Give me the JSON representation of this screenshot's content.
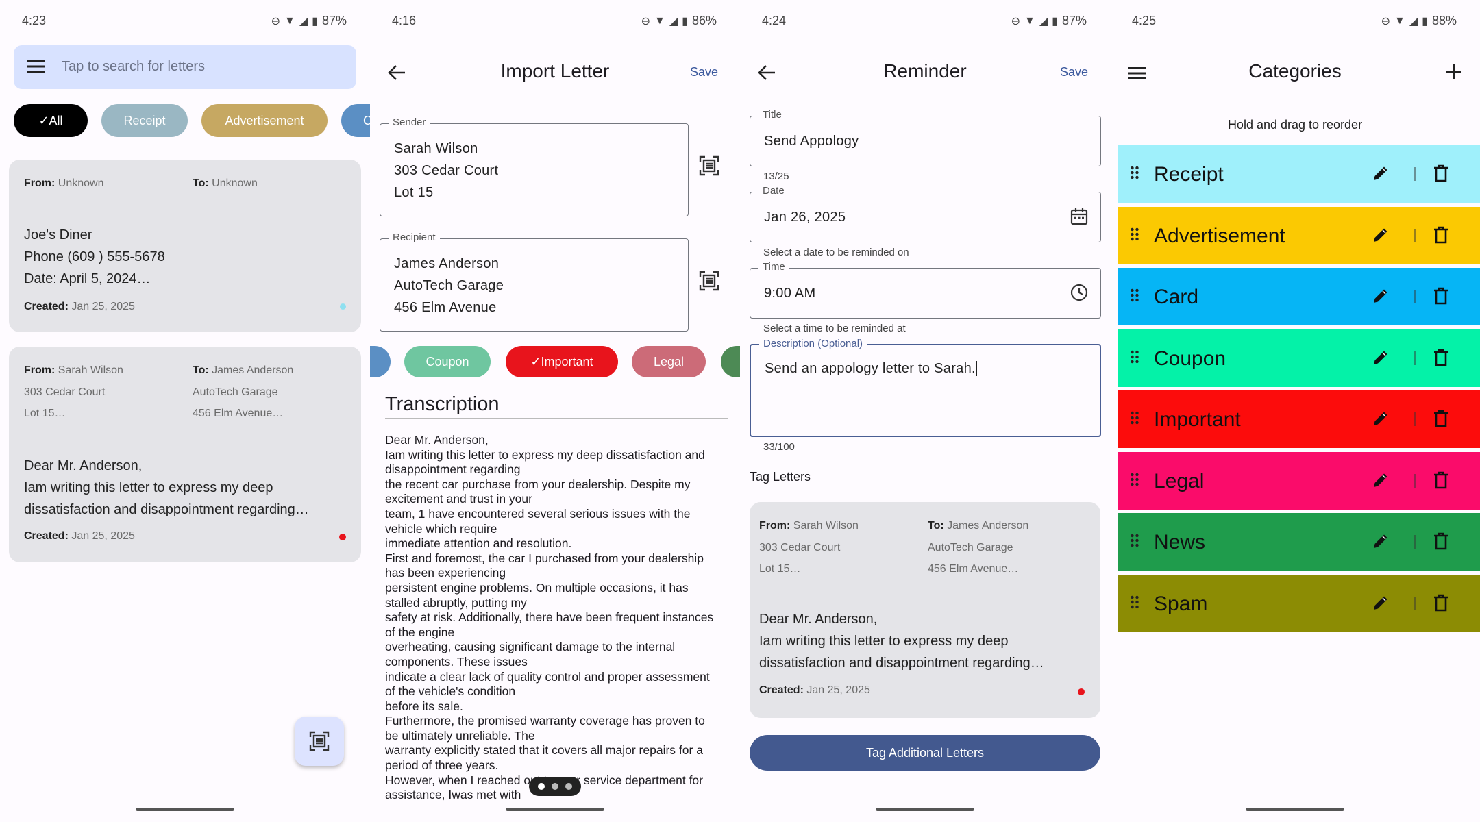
{
  "screen1": {
    "status": {
      "time": "4:23",
      "battery": "87%"
    },
    "search": {
      "placeholder": "Tap to search for letters"
    },
    "filters": [
      {
        "label": "All",
        "color": "#000000"
      },
      {
        "label": "Receipt",
        "color": "#9ab7c3"
      },
      {
        "label": "Advertisement",
        "color": "#c6a862"
      },
      {
        "label": "C",
        "color": "#5b8fc4"
      }
    ],
    "letters": [
      {
        "from_label": "From:",
        "from": "Unknown",
        "to_label": "To:",
        "to": "Unknown",
        "body": [
          "Joe's Diner",
          "Phone (609 ) 555-5678",
          "Date: April 5, 2024…"
        ],
        "created_label": "Created:",
        "created": "Jan 25, 2025",
        "dot_color": "#8fe0f0"
      },
      {
        "from_label": "From:",
        "from": "Sarah Wilson",
        "from_lines": [
          "303 Cedar Court",
          "Lot 15…"
        ],
        "to_label": "To:",
        "to": "James Anderson",
        "to_lines": [
          "AutoTech Garage",
          "456 Elm Avenue…"
        ],
        "body": [
          "Dear Mr. Anderson,",
          "Iam writing this letter to express my deep",
          "dissatisfaction and disappointment regarding…"
        ],
        "created_label": "Created:",
        "created": "Jan 25, 2025",
        "dot_color": "#e8141c"
      }
    ],
    "fab_icon": "scan-document-icon"
  },
  "screen2": {
    "status": {
      "time": "4:16",
      "battery": "86%"
    },
    "title": "Import Letter",
    "save": "Save",
    "sender": {
      "label": "Sender",
      "lines": [
        "Sarah Wilson",
        "303 Cedar Court",
        "Lot 15"
      ]
    },
    "recipient": {
      "label": "Recipient",
      "lines": [
        "James Anderson",
        "AutoTech Garage",
        "456 Elm Avenue"
      ]
    },
    "tags": [
      {
        "label": "",
        "color": "#5b8fc4"
      },
      {
        "label": "Coupon",
        "color": "#6fc6a0"
      },
      {
        "label": "Important",
        "color": "#e8141c",
        "selected": true
      },
      {
        "label": "Legal",
        "color": "#cc6b78"
      },
      {
        "label": "",
        "color": "#4d8a55"
      }
    ],
    "transcription_heading": "Transcription",
    "transcription": [
      "Dear Mr. Anderson,",
      "Iam writing this letter to express my deep dissatisfaction and",
      "disappointment regarding",
      "the recent car purchase from your dealership. Despite my",
      "excitement and trust in your",
      "team, 1 have encountered several serious issues with the",
      "vehicle which require",
      "immediate attention and resolution.",
      "First and foremost, the car I purchased from your dealership",
      "has been experiencing",
      "persistent engine problems. On multiple occasions, it has",
      "stalled abruptly, putting my",
      "safety at risk. Additionally, there have been frequent instances",
      "of the engine",
      "overheating, causing significant damage to the internal",
      "components. These issues",
      "indicate a clear lack of quality control and proper assessment",
      "of the vehicle's condition",
      "before its sale.",
      "Furthermore, the promised warranty coverage has proven to",
      "be ultimately unreliable. The",
      "warranty explicitly stated that it covers all major repairs for a",
      "period of three years.",
      "However, when I reached out to your service department for",
      "assistance, Iwas met with"
    ]
  },
  "screen3": {
    "status": {
      "time": "4:24",
      "battery": "87%"
    },
    "title": "Reminder",
    "save": "Save",
    "title_field": {
      "label": "Title",
      "value": "Send Appology",
      "counter": "13/25"
    },
    "date_field": {
      "label": "Date",
      "value": "Jan 26, 2025",
      "helper": "Select a date to be reminded on"
    },
    "time_field": {
      "label": "Time",
      "value": "9:00 AM",
      "helper": "Select a time to be reminded at"
    },
    "desc_field": {
      "label": "Description (Optional)",
      "value": "Send an appology letter to Sarah.",
      "counter": "33/100"
    },
    "tag_letters": "Tag Letters",
    "letter": {
      "from_label": "From:",
      "from": "Sarah Wilson",
      "from_lines": [
        "303 Cedar Court",
        "Lot 15…"
      ],
      "to_label": "To:",
      "to": "James Anderson",
      "to_lines": [
        "AutoTech Garage",
        "456 Elm Avenue…"
      ],
      "body": [
        "Dear Mr. Anderson,",
        "Iam writing this letter to express my deep",
        "dissatisfaction and disappointment regarding…"
      ],
      "created_label": "Created:",
      "created": "Jan 25, 2025",
      "dot_color": "#e8141c"
    },
    "button": "Tag Additional Letters"
  },
  "screen4": {
    "status": {
      "time": "4:25",
      "battery": "88%"
    },
    "title": "Categories",
    "hint": "Hold and drag to reorder",
    "categories": [
      {
        "name": "Receipt",
        "color": "#9ff0fb"
      },
      {
        "name": "Advertisement",
        "color": "#fbc902"
      },
      {
        "name": "Card",
        "color": "#06b5f5"
      },
      {
        "name": "Coupon",
        "color": "#04f2a8"
      },
      {
        "name": "Important",
        "color": "#fc0c0c"
      },
      {
        "name": "Legal",
        "color": "#fa0c6a"
      },
      {
        "name": "News",
        "color": "#1f9c4c"
      },
      {
        "name": "Spam",
        "color": "#8c8c04"
      }
    ]
  }
}
